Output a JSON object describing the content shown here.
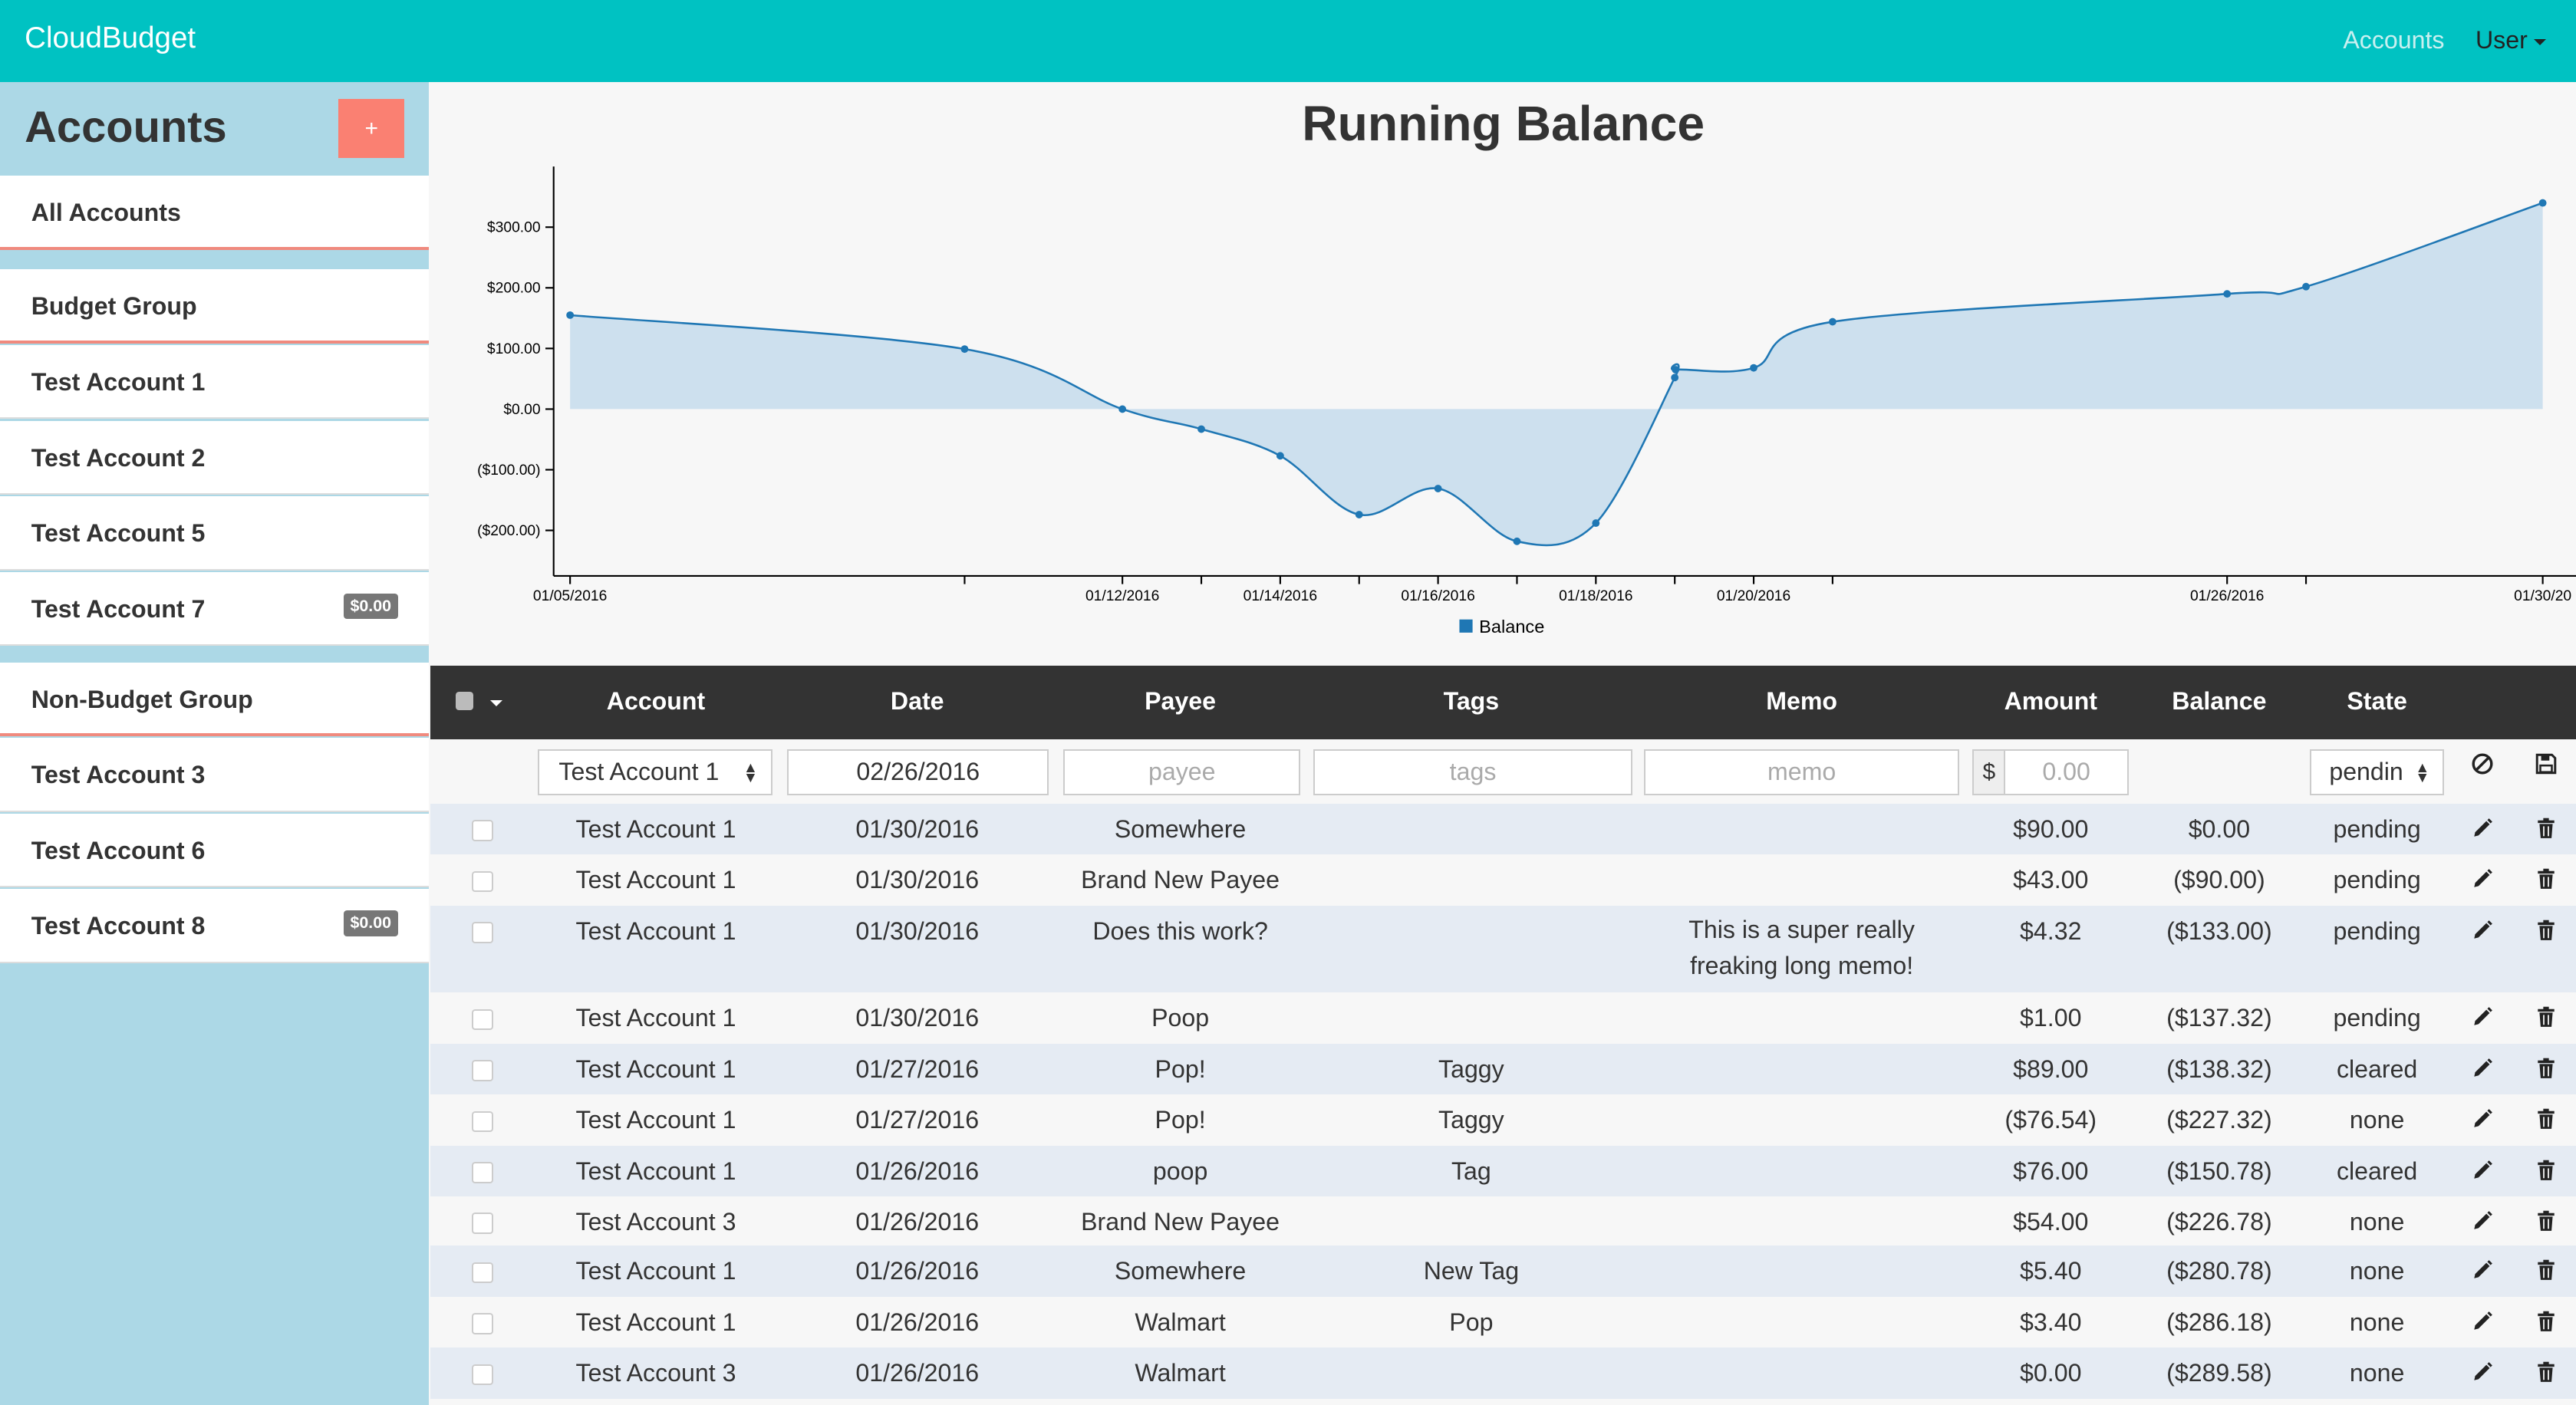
{
  "navbar": {
    "brand": "CloudBudget",
    "accounts_link": "Accounts",
    "user_menu": "User"
  },
  "sidebar": {
    "title": "Accounts",
    "add_label": "+",
    "items": [
      {
        "label": "All Accounts",
        "type": "group"
      },
      {
        "label": "Budget Group",
        "type": "group"
      },
      {
        "label": "Test Account 1"
      },
      {
        "label": "Test Account 2"
      },
      {
        "label": "Test Account 5"
      },
      {
        "label": "Test Account 7",
        "badge": "$0.00"
      },
      {
        "label": "Non-Budget Group",
        "type": "group"
      },
      {
        "label": "Test Account 3"
      },
      {
        "label": "Test Account 6"
      },
      {
        "label": "Test Account 8",
        "badge": "$0.00"
      }
    ]
  },
  "chart_data": {
    "type": "area",
    "title": "Running Balance",
    "legend": [
      "Balance"
    ],
    "legend_position": "bottom-center",
    "series_color": "#1f77b4",
    "fill_color": "#cde0ee",
    "x_tick_labels": [
      "01/05/2016",
      "01/12/2016",
      "01/14/2016",
      "01/16/2016",
      "01/18/2016",
      "01/20/2016",
      "01/26/2016",
      "01/30/20"
    ],
    "y_tick_labels": [
      "$300.00",
      "$200.00",
      "$100.00",
      "$0.00",
      "($100.00)",
      "($200.00)"
    ],
    "ylim": [
      -275,
      400
    ],
    "series": [
      {
        "name": "Balance",
        "points": [
          {
            "x": "2016-01-05",
            "y": 155
          },
          {
            "x": "2016-01-10",
            "y": 99
          },
          {
            "x": "2016-01-12",
            "y": 0
          },
          {
            "x": "2016-01-13",
            "y": -33
          },
          {
            "x": "2016-01-14",
            "y": -77
          },
          {
            "x": "2016-01-15",
            "y": -174
          },
          {
            "x": "2016-01-16",
            "y": -131
          },
          {
            "x": "2016-01-17",
            "y": -218
          },
          {
            "x": "2016-01-18",
            "y": -188
          },
          {
            "x": "2016-01-19",
            "y": 52
          },
          {
            "x": "2016-01-19",
            "y": 65
          },
          {
            "x": "2016-01-20",
            "y": 68
          },
          {
            "x": "2016-01-21",
            "y": 144
          },
          {
            "x": "2016-01-26",
            "y": 190
          },
          {
            "x": "2016-01-27",
            "y": 202
          },
          {
            "x": "2016-01-30",
            "y": 340
          }
        ]
      }
    ]
  },
  "table": {
    "headers": {
      "account": "Account",
      "date": "Date",
      "payee": "Payee",
      "tags": "Tags",
      "memo": "Memo",
      "amount": "Amount",
      "balance": "Balance",
      "state": "State"
    },
    "new_row": {
      "account": "Test Account 1",
      "date": "02/26/2016",
      "payee_placeholder": "payee",
      "tags_placeholder": "tags",
      "memo_placeholder": "memo",
      "currency_symbol": "$",
      "amount_placeholder": "0.00",
      "state": "pendin"
    },
    "rows": [
      {
        "account": "Test Account 1",
        "date": "01/30/2016",
        "payee": "Somewhere",
        "tags": "",
        "memo": "",
        "amount": "$90.00",
        "balance": "$0.00",
        "state": "pending"
      },
      {
        "account": "Test Account 1",
        "date": "01/30/2016",
        "payee": "Brand New Payee",
        "tags": "",
        "memo": "",
        "amount": "$43.00",
        "balance": "($90.00)",
        "state": "pending"
      },
      {
        "account": "Test Account 1",
        "date": "01/30/2016",
        "payee": "Does this work?",
        "tags": "",
        "memo": "This is a super really freaking long memo!",
        "amount": "$4.32",
        "balance": "($133.00)",
        "state": "pending"
      },
      {
        "account": "Test Account 1",
        "date": "01/30/2016",
        "payee": "Poop",
        "tags": "",
        "memo": "",
        "amount": "$1.00",
        "balance": "($137.32)",
        "state": "pending"
      },
      {
        "account": "Test Account 1",
        "date": "01/27/2016",
        "payee": "Pop!",
        "tags": "Taggy",
        "memo": "",
        "amount": "$89.00",
        "balance": "($138.32)",
        "state": "cleared"
      },
      {
        "account": "Test Account 1",
        "date": "01/27/2016",
        "payee": "Pop!",
        "tags": "Taggy",
        "memo": "",
        "amount": "($76.54)",
        "balance": "($227.32)",
        "state": "none"
      },
      {
        "account": "Test Account 1",
        "date": "01/26/2016",
        "payee": "poop",
        "tags": "Tag",
        "memo": "",
        "amount": "$76.00",
        "balance": "($150.78)",
        "state": "cleared"
      },
      {
        "account": "Test Account 3",
        "date": "01/26/2016",
        "payee": "Brand New Payee",
        "tags": "",
        "memo": "",
        "amount": "$54.00",
        "balance": "($226.78)",
        "state": "none"
      },
      {
        "account": "Test Account 1",
        "date": "01/26/2016",
        "payee": "Somewhere",
        "tags": "New Tag",
        "memo": "",
        "amount": "$5.40",
        "balance": "($280.78)",
        "state": "none"
      },
      {
        "account": "Test Account 1",
        "date": "01/26/2016",
        "payee": "Walmart",
        "tags": "Pop",
        "memo": "",
        "amount": "$3.40",
        "balance": "($286.18)",
        "state": "none"
      },
      {
        "account": "Test Account 3",
        "date": "01/26/2016",
        "payee": "Walmart",
        "tags": "",
        "memo": "",
        "amount": "$0.00",
        "balance": "($289.58)",
        "state": "none"
      }
    ]
  }
}
